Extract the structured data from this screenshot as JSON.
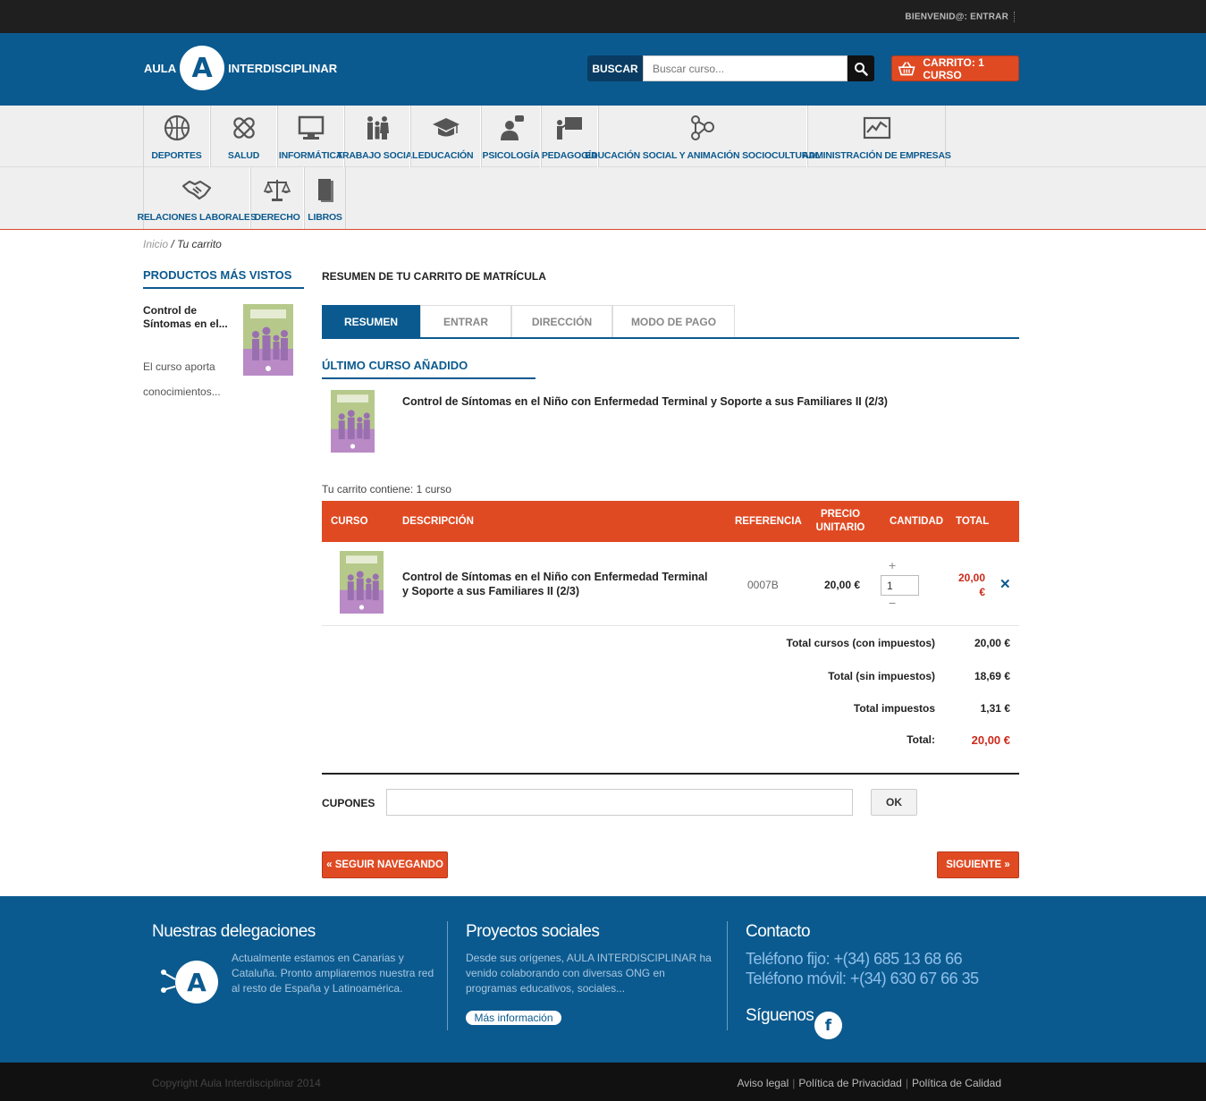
{
  "topbar": {
    "welcome": "BIENVENID@: ENTRAR"
  },
  "header": {
    "logo_left": "AULA",
    "logo_mark": "A",
    "logo_right": "INTERDISCIPLINAR",
    "search_label": "BUSCAR",
    "search_placeholder": "Buscar curso...",
    "cart_label": "CARRITO: 1 CURSO"
  },
  "nav": {
    "row1": [
      {
        "label": "DEPORTES",
        "icon": "basketball-icon"
      },
      {
        "label": "SALUD",
        "icon": "bandage-icon"
      },
      {
        "label": "INFORMÁTICA",
        "icon": "monitor-icon"
      },
      {
        "label": "TRABAJO SOCIAL",
        "icon": "family-icon"
      },
      {
        "label": "EDUCACIÓN",
        "icon": "graduation-cap-icon"
      },
      {
        "label": "PSICOLOGÍA",
        "icon": "speaker-bubble-icon"
      },
      {
        "label": "PEDAGOGÍA",
        "icon": "teacher-board-icon"
      },
      {
        "label": "EDUCACIÓN SOCIAL Y ANIMACIÓN SOCIOCULTURAL",
        "icon": "network-people-icon"
      },
      {
        "label": "ADMINISTRACIÓN DE EMPRESAS",
        "icon": "chart-line-icon"
      }
    ],
    "row2": [
      {
        "label": "RELACIONES LABORALES",
        "icon": "handshake-icon"
      },
      {
        "label": "DERECHO",
        "icon": "scales-icon"
      },
      {
        "label": "LIBROS",
        "icon": "book-icon"
      }
    ]
  },
  "breadcrumb": {
    "home": "Inicio",
    "sep": "/",
    "current": "Tu carrito"
  },
  "sidebar": {
    "title": "PRODUCTOS MÁS VISTOS",
    "product_title": "Control de Síntomas en el...",
    "product_desc": "El curso aporta conocimientos..."
  },
  "main": {
    "title": "RESUMEN DE TU CARRITO DE MATRÍCULA",
    "steps": [
      "RESUMEN",
      "ENTRAR",
      "DIRECCIÓN",
      "MODO DE PAGO"
    ],
    "last_added_title": "ÚLTIMO CURSO AÑADIDO",
    "last_added_name": "Control de Síntomas en el Niño con Enfermedad Terminal y Soporte a sus Familiares II (2/3)",
    "contains": "Tu carrito contiene: 1 curso",
    "table_head": {
      "course": "CURSO",
      "description": "DESCRIPCIÓN",
      "reference": "REFERENCIA",
      "unit_price": "PRECIO UNITARIO",
      "quantity": "CANTIDAD",
      "total": "TOTAL"
    },
    "row": {
      "description": "Control de Síntomas en el Niño con Enfermedad Terminal y Soporte a sus Familiares II (2/3)",
      "reference": "0007B",
      "unit_price": "20,00 €",
      "qty_plus": "+",
      "quantity": "1",
      "qty_minus": "−",
      "total": "20,00 €",
      "delete": "✕"
    },
    "summary": [
      {
        "label": "Total cursos (con impuestos)",
        "value": "20,00 €"
      },
      {
        "label": "Total (sin impuestos)",
        "value": "18,69 €"
      },
      {
        "label": "Total impuestos",
        "value": "1,31 €"
      },
      {
        "label": "Total:",
        "value": "20,00 €"
      }
    ],
    "coupon_label": "CUPONES",
    "coupon_ok": "OK",
    "back_button": "« SEGUIR NAVEGANDO",
    "next_button": "SIGUIENTE »"
  },
  "footer": {
    "col1_title": "Nuestras delegaciones",
    "col1_text": "Actualmente estamos en Canarias y Cataluña. Pronto ampliaremos nuestra red al resto de España y Latinoamérica.",
    "col2_title": "Proyectos sociales",
    "col2_text": "Desde sus orígenes, AULA INTERDISCIPLINAR ha venido colaborando con diversas ONG en programas educativos, sociales...",
    "col2_link": "Más información",
    "col3_title": "Contacto",
    "phone1": "Teléfono fijo: +(34) 685 13 68 66",
    "phone2": "Teléfono móvil: +(34) 630 67 66 35",
    "follow": "Síguenos",
    "fb": "f"
  },
  "bottom": {
    "copyright": "Copyright Aula Interdisciplinar 2014",
    "legal1": "Aviso legal",
    "legal2": "Política de Privacidad",
    "legal3": "Política de Calidad"
  },
  "colors": {
    "brand_blue": "#0b5a8f",
    "accent_red": "#e04a23",
    "price_red": "#cc2a1a"
  }
}
